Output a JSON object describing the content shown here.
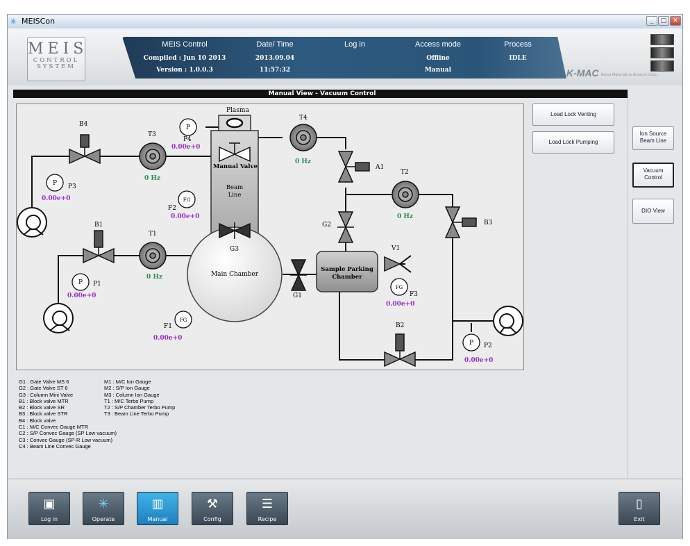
{
  "window": {
    "title": "MEISCon"
  },
  "logo": {
    "line1": "MEIS",
    "line2": "CONTROL",
    "line3": "SYSTEM"
  },
  "header": {
    "columns": [
      {
        "label": "MEIS Control",
        "v1": "Compiled : Jun 10 2013",
        "v2": "Version : 1.0.0.3"
      },
      {
        "label": "Date/ Time",
        "v1": "2013.09.04",
        "v2": "11:57:32"
      },
      {
        "label": "Log in",
        "v1": "",
        "v2": ""
      },
      {
        "label": "Access mode",
        "v1": "Offline",
        "v2": "Manual"
      },
      {
        "label": "Process",
        "v1": "IDLE",
        "v2": ""
      }
    ],
    "brand": "K-MAC",
    "brand_sub": "Korea Materials & Analysis Corp."
  },
  "view": {
    "title": "Manual View - Vacuum Control"
  },
  "diagram": {
    "plasma": "Plasma",
    "manual_valve": "Manual Valve",
    "beam_line": [
      "Beam",
      "Line"
    ],
    "main_chamber": "Main Chamber",
    "spc": [
      "Sample Parking",
      "Chamber"
    ],
    "labels": {
      "B4": "B4",
      "T3": "T3",
      "P4": "P4",
      "T4": "T4",
      "A1": "A1",
      "T2": "T2",
      "P3": "P3",
      "F2": "F2",
      "B3": "B3",
      "G2": "G2",
      "B1": "B1",
      "T1": "T1",
      "G3": "G3",
      "V1": "V1",
      "P1": "P1",
      "G1": "G1",
      "F3": "F3",
      "F1": "F1",
      "B2": "B2",
      "P2": "P2"
    },
    "circles": {
      "P": "P",
      "FG": "FG"
    },
    "values": {
      "T3_hz": "0 Hz",
      "T4_hz": "0 Hz",
      "T2_hz": "0 Hz",
      "T1_hz": "0 Hz",
      "P4": "0.00e+0",
      "P3": "0.00e+0",
      "F2": "0.00e+0",
      "P1": "0.00e+0",
      "F3": "0.00e+0",
      "F1": "0.00e+0",
      "P2": "0.00e+0"
    },
    "colors": {
      "hz": "#2e8b57",
      "pressure": "#9b2fc9"
    }
  },
  "actions": {
    "venting": "Load Lock Venting",
    "pumping": "Load Lock Pumping"
  },
  "side": {
    "ion": [
      "Ion Source",
      "Beam Line"
    ],
    "vac": [
      "Vacuum",
      "Control"
    ],
    "dio": "DIO View"
  },
  "legend": {
    "col1": [
      "G1 : Gate Valve MS 6",
      "G2 : Gate Valve ST 6",
      "G3 : Column Mini Valve",
      "B1 : Block valve MTR",
      "B2 : Block valve SR",
      "B3 : Block valve STR",
      "B4 : Block valve",
      "C1 : M/C Convec Gauge MTR",
      "C2 : S/P Convec Gauge (SP Low vacuum)",
      "C3 : Convec Gauge (SP-R Low vacuum)",
      "C4 : Beam Line Convec Gauge"
    ],
    "col2": [
      "M1 : M/C Ion Gauge",
      "M2 : S/P Ion Gauge",
      "M3 : Column Ion Gauge",
      "T1 : M/C Terbo Pump",
      "T2 : S/P Chamber Terbo Pump",
      "T3 : Beam Line Terbo Pump"
    ]
  },
  "toolbar": {
    "login": "Log in",
    "operate": "Operate",
    "manual": "Manual",
    "config": "Config",
    "recipe": "Recipe",
    "exit": "Exit"
  }
}
